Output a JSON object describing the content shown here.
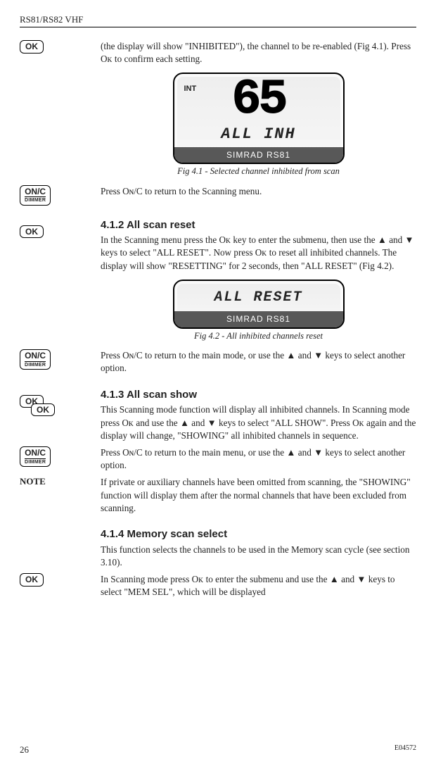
{
  "header": {
    "model": "RS81/RS82 VHF"
  },
  "buttons": {
    "ok": "OK",
    "onc_top": "ON/C",
    "onc_sub": "DIMMER"
  },
  "para1": "(the display will show \"INHIBITED\"), the channel to be re-enabled (Fig 4.1). Press Oᴋ to confirm each setting.",
  "fig41": {
    "int": "INT",
    "channel": "65",
    "text": "ALL INH",
    "footer": "SIMRAD RS81",
    "caption": "Fig 4.1 - Selected channel inhibited from scan"
  },
  "para2": "Press Oɴ/C to return to the Scanning menu.",
  "sec412": {
    "title": "4.1.2  All scan reset",
    "body": "In the Scanning menu press the Oᴋ key to enter the submenu, then use the ▲ and ▼ keys to select \"ALL RESET\". Now press Oᴋ to reset all inhibited channels. The display will show \"RESETTING\" for 2 seconds, then \"ALL RESET\" (Fig 4.2)."
  },
  "fig42": {
    "text": "ALL RESET",
    "footer": "SIMRAD RS81",
    "caption": "Fig 4.2 - All inhibited channels reset"
  },
  "para3": "Press Oɴ/C to return to the main mode, or use the ▲ and ▼ keys to select another option.",
  "sec413": {
    "title": "4.1.3  All scan show",
    "body": "This Scanning mode function will display all inhibited channels. In Scanning mode press Oᴋ and use the ▲ and ▼ keys to select \"ALL SHOW\". Press Oᴋ again and the display will change, \"SHOWING\" all inhibited channels in sequence."
  },
  "para4": "Press Oɴ/C to return to the main menu, or use the ▲ and ▼ keys to select another option.",
  "note_label": "NOTE",
  "para5": "If private or auxiliary channels have been omitted from scanning, the \"SHOWING\" function will display them after the normal channels that have been excluded from scanning.",
  "sec414": {
    "title": "4.1.4  Memory scan select",
    "body": "This function selects the channels to be used in the Memory scan cycle (see section 3.10).",
    "body2": "In Scanning mode press Oᴋ to enter the submenu and use the ▲ and ▼ keys to select \"MEM SEL\", which will be displayed"
  },
  "footer": {
    "page": "26",
    "docnum": "E04572"
  }
}
